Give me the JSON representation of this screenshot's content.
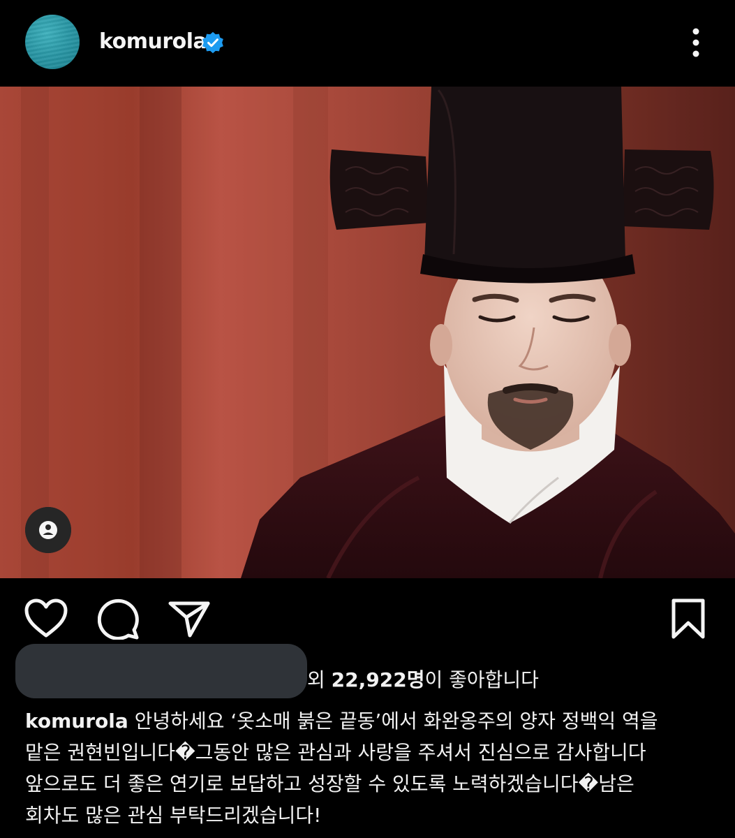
{
  "header": {
    "username": "komurola",
    "verified": true,
    "avatar_color": "#2a98a6",
    "more_icon": "more-vertical-icon"
  },
  "post": {
    "photo_background": "#b24c3b",
    "tag_icon": "user-tag-icon"
  },
  "actions": {
    "like_icon": "heart-icon",
    "comment_icon": "comment-icon",
    "share_icon": "send-icon",
    "save_icon": "bookmark-icon"
  },
  "likes": {
    "prefix": "외 ",
    "count": "22,922명",
    "suffix": "이 좋아합니다"
  },
  "caption": {
    "username": "komurola",
    "line1": " 안녕하세요 ‘옷소매 붉은 끝동’에서 화완옹주의 양자 정백익 역을",
    "line2": "맡은 권현빈입니다�그동안 많은 관심과 사랑을 주셔서 진심으로 감사합니다",
    "line3": "앞으로도 더 좋은 연기로 보답하고 성장할 수 있도록 노력하겠습니다�남은",
    "line4": "회차도 많은 관심 부탁드리겠습니다!"
  }
}
